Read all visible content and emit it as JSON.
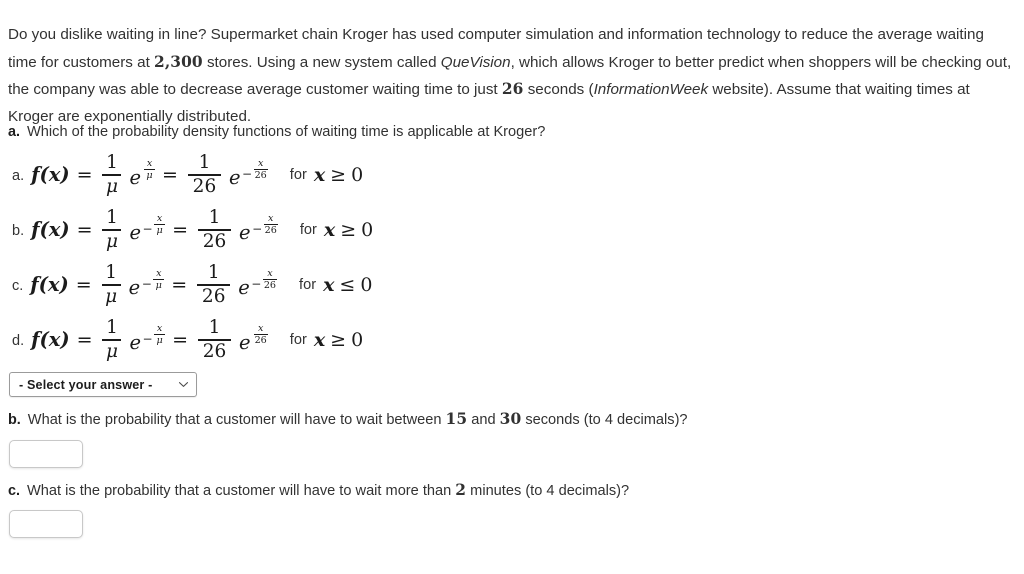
{
  "intro": {
    "s1": "Do you dislike waiting in line? Supermarket chain Kroger has used computer simulation and information technology to reduce the average waiting time for customers at ",
    "stores_count": "2,300",
    "s2": " stores. Using a new system called ",
    "system_name": "QueVision",
    "s3": ", which allows Kroger to better predict when shoppers will be checking out, the company was able to decrease average customer waiting time to just ",
    "mean_seconds": "26",
    "s4": " seconds (",
    "source_name": "InformationWeek",
    "s5": " website). Assume that waiting times at Kroger are exponentially distributed."
  },
  "questions": {
    "a": {
      "letter": "a.",
      "text": "Which of the probability density functions of waiting time is applicable at Kroger?"
    },
    "b": {
      "letter": "b.",
      "text": "What is the probability that a customer will have to wait between 15 and 30 seconds (to 4 decimals)?",
      "lead": "What is the probability that a customer will have to wait between ",
      "lower": "15",
      "mid": " and ",
      "upper": "30",
      "tail": " seconds (to 4 decimals)?",
      "answer_value": "",
      "answer_placeholder": ""
    },
    "c": {
      "letter": "c.",
      "text": "What is the probability that a customer will have to wait more than 2 minutes (to 4 decimals)?",
      "lead": "What is the probability that a customer will have to wait more than ",
      "threshold": "2",
      "tail": " minutes (to 4 decimals)?",
      "answer_value": "",
      "answer_placeholder": ""
    }
  },
  "options": [
    {
      "tag": "a.",
      "fn": "f(x)",
      "num1": "1",
      "den1": "μ",
      "exp1_sign": "",
      "exp1_num": "x",
      "exp1_den": "μ",
      "num2": "1",
      "den2": "26",
      "exp2_sign": "−",
      "exp2_num": "x",
      "exp2_den": "26",
      "cond_label": "for",
      "cond_var": "x",
      "cond_rel": "≥",
      "cond_val": "0"
    },
    {
      "tag": "b.",
      "fn": "f(x)",
      "num1": "1",
      "den1": "μ",
      "exp1_sign": "−",
      "exp1_num": "x",
      "exp1_den": "μ",
      "num2": "1",
      "den2": "26",
      "exp2_sign": "−",
      "exp2_num": "x",
      "exp2_den": "26",
      "cond_label": "for",
      "cond_var": "x",
      "cond_rel": "≥",
      "cond_val": "0"
    },
    {
      "tag": "c.",
      "fn": "f(x)",
      "num1": "1",
      "den1": "μ",
      "exp1_sign": "−",
      "exp1_num": "x",
      "exp1_den": "μ",
      "num2": "1",
      "den2": "26",
      "exp2_sign": "−",
      "exp2_num": "x",
      "exp2_den": "26",
      "cond_label": "for",
      "cond_var": "x",
      "cond_rel": "≤",
      "cond_val": "0"
    },
    {
      "tag": "d.",
      "fn": "f(x)",
      "num1": "1",
      "den1": "μ",
      "exp1_sign": "−",
      "exp1_num": "x",
      "exp1_den": "μ",
      "num2": "1",
      "den2": "26",
      "exp2_sign": "",
      "exp2_num": "x",
      "exp2_den": "26",
      "cond_label": "for",
      "cond_var": "x",
      "cond_rel": "≥",
      "cond_val": "0"
    }
  ],
  "select": {
    "selected_label": "- Select your answer -",
    "icon": "chevron-down-icon"
  },
  "equals_sign": "=",
  "colors": {
    "text": "#323232",
    "math": "#1b1b1b",
    "input_border": "#c8c8c8",
    "select_border": "#9b9b9b",
    "background": "#ffffff"
  }
}
